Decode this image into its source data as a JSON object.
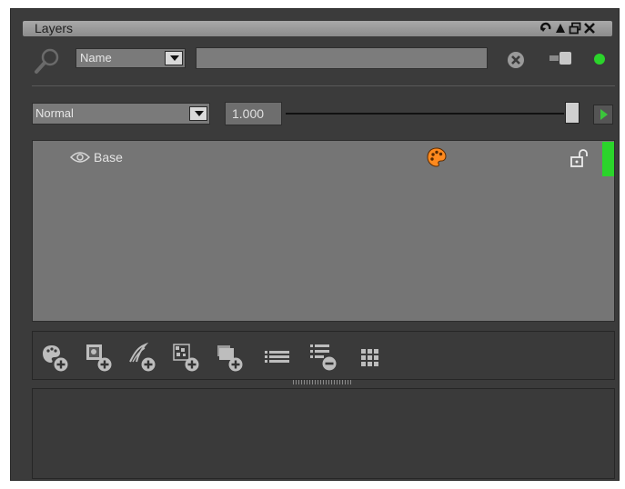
{
  "window": {
    "title": "Layers"
  },
  "search": {
    "field_option": "Name",
    "text_value": ""
  },
  "blend": {
    "mode": "Normal",
    "opacity": "1.000",
    "opacity_slider": 1.0
  },
  "layers": [
    {
      "name": "Base",
      "visible": true,
      "locked": false,
      "active": true
    }
  ],
  "toolbar": {
    "tools": [
      "add-paint-layer-icon",
      "add-fill-layer-icon",
      "add-stroke-layer-icon",
      "add-procedural-layer-icon",
      "add-folder-icon",
      "list-view-icon",
      "remove-layer-icon",
      "grid-view-icon"
    ]
  },
  "colors": {
    "active_green": "#2bd42b",
    "palette_orange": "#ff8a1e"
  }
}
